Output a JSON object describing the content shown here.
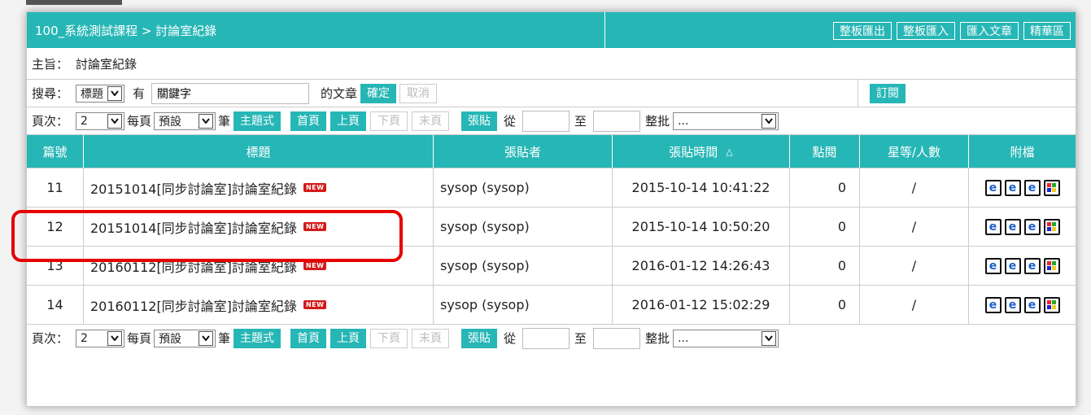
{
  "header": {
    "breadcrumb": "100_系統測試課程 > 討論室紀錄",
    "buttons": [
      "整板匯出",
      "整板匯入",
      "匯入文章",
      "精華區"
    ]
  },
  "subject": {
    "label": "主旨：",
    "value": "討論室紀錄"
  },
  "search": {
    "label": "搜尋：",
    "field_select": "標題",
    "has_label": "有",
    "keyword_value": "關鍵字",
    "suffix_label": "的文章",
    "confirm": "確定",
    "cancel": "取消",
    "subscribe": "訂閱"
  },
  "pager": {
    "page_label": "頁次：",
    "page_value": "2",
    "per_page_label": "每頁",
    "per_page_value": "預設",
    "unit_label": "筆",
    "thread_mode": "主題式",
    "first": "首頁",
    "prev": "上頁",
    "next": "下頁",
    "last": "末頁",
    "post": "張貼",
    "from_label": "從",
    "to_label": "至",
    "batch_label": "整批",
    "batch_value": "..."
  },
  "table": {
    "headers": [
      "篇號",
      "標題",
      "張貼者",
      "張貼時間",
      "點閱",
      "星等/人數",
      "附檔"
    ],
    "sort_indicator": "△",
    "new_badge": "NEW",
    "rows": [
      {
        "no": "11",
        "title": "20151014[同步討論室]討論室紀錄",
        "author": "sysop (sysop)",
        "time": "2015-10-14 10:41:22",
        "views": "0",
        "stars": "/"
      },
      {
        "no": "12",
        "title": "20151014[同步討論室]討論室紀錄",
        "author": "sysop (sysop)",
        "time": "2015-10-14 10:50:20",
        "views": "0",
        "stars": "/"
      },
      {
        "no": "13",
        "title": "20160112[同步討論室]討論室紀錄",
        "author": "sysop (sysop)",
        "time": "2016-01-12 14:26:43",
        "views": "0",
        "stars": "/"
      },
      {
        "no": "14",
        "title": "20160112[同步討論室]討論室紀錄",
        "author": "sysop (sysop)",
        "time": "2016-01-12 15:02:29",
        "views": "0",
        "stars": "/"
      }
    ]
  },
  "colors": {
    "accent": "#27b6b6",
    "highlight": "#e60000",
    "new_badge": "#d21a1a"
  }
}
